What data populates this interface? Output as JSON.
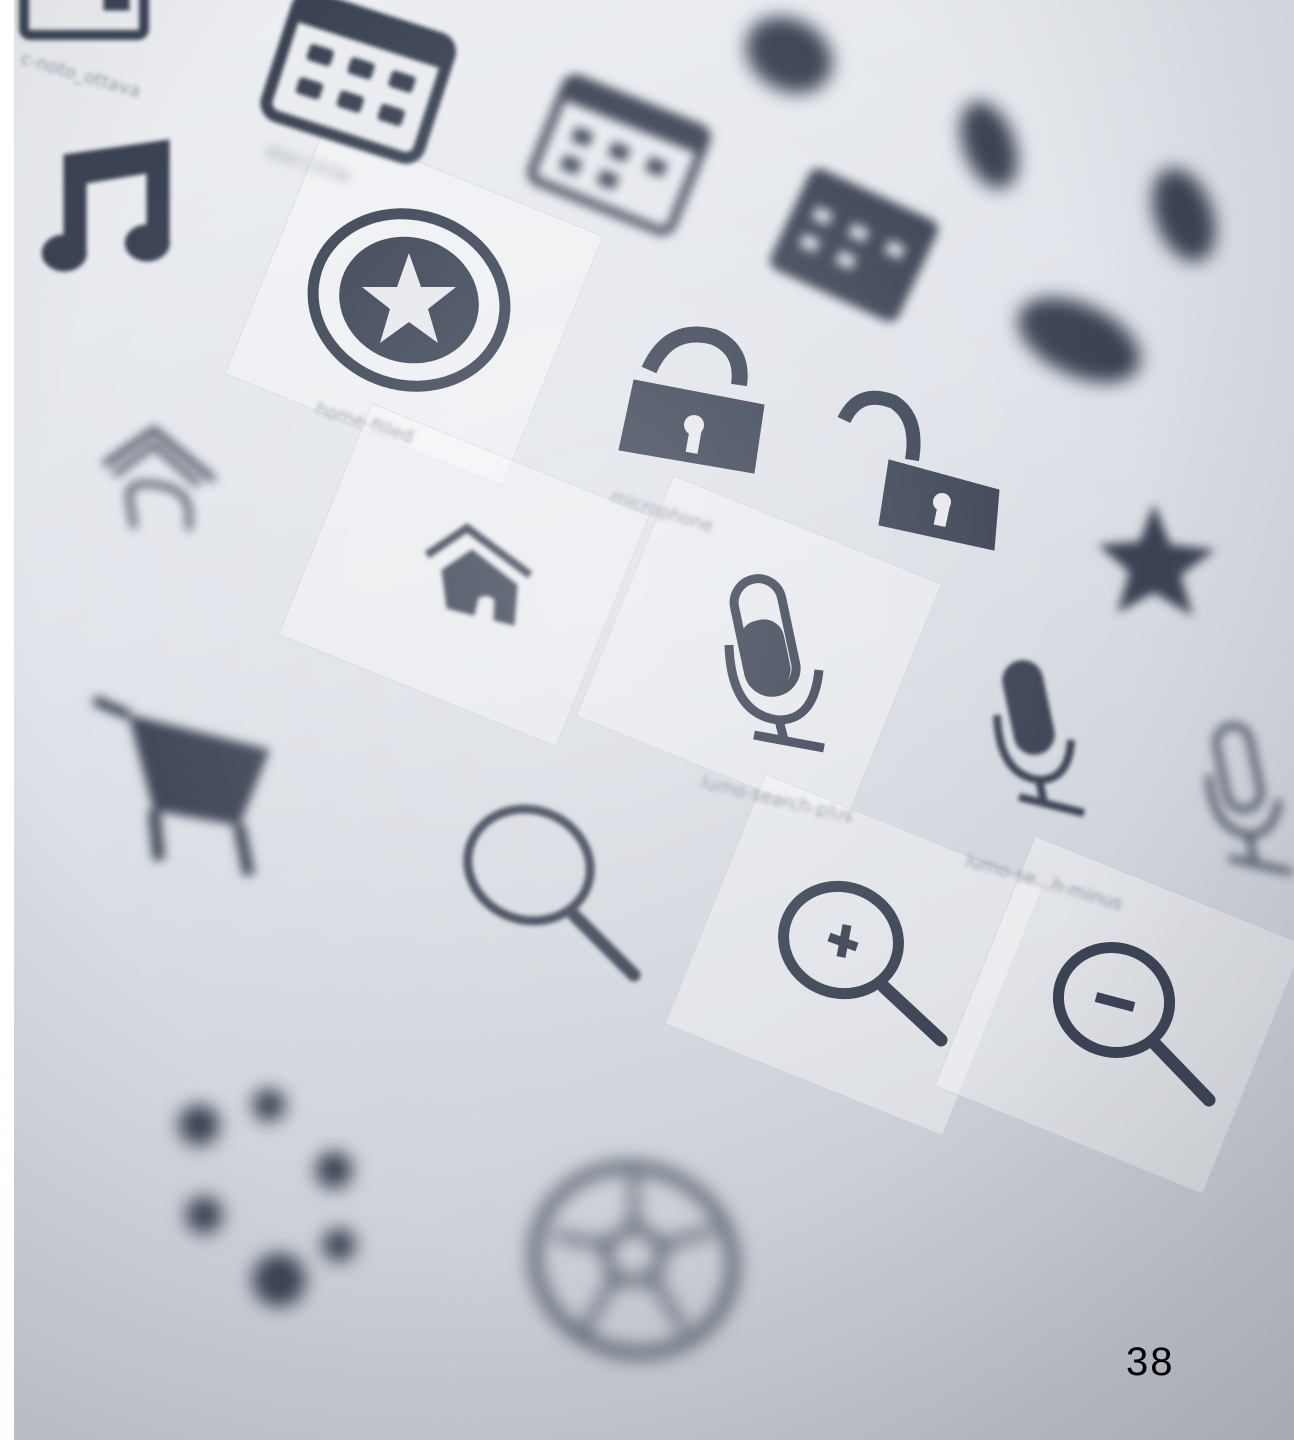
{
  "photo": {
    "labels": {
      "note_ottava": "c-noto_ottava",
      "star_circle": "star-circle",
      "home_filled": "home-filled",
      "microphone": "microphone",
      "search_plus": "lumo-search-plus",
      "search_minus": "lumo-se...h-minus"
    },
    "icons": [
      "calendar-icon",
      "music-note-icon",
      "star-circle-icon",
      "lock-icon",
      "unlock-icon",
      "star-icon",
      "home-outline-icon",
      "home-filled-icon",
      "microphone-icon",
      "microphone-filled-icon",
      "shopping-cart-icon",
      "search-icon",
      "search-plus-icon",
      "search-minus-icon",
      "spinner-icon",
      "soccer-ball-icon"
    ],
    "icon_color": "#3a4253"
  },
  "page_number": "38"
}
